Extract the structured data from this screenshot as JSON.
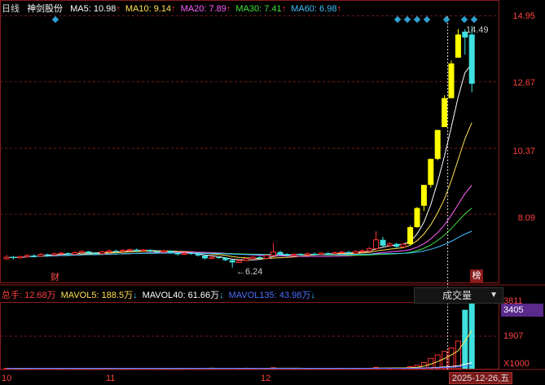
{
  "header": {
    "period": "日线",
    "stock_name": "神剑股份",
    "ma": [
      {
        "label": "MA5",
        "value": "10.98",
        "arrow": "↑",
        "color": "#ffffff"
      },
      {
        "label": "MA10",
        "value": "9.14",
        "arrow": "↑",
        "color": "#ffe050"
      },
      {
        "label": "MA20",
        "value": "7.89",
        "arrow": "↑",
        "color": "#ff60ff"
      },
      {
        "label": "MA30",
        "value": "7.41",
        "arrow": "↑",
        "color": "#40e040"
      },
      {
        "label": "MA60",
        "value": "6.98",
        "arrow": "↑",
        "color": "#40c0ff"
      }
    ]
  },
  "price_axis": [
    "14.95",
    "12.67",
    "10.37",
    "8.09"
  ],
  "annotations": {
    "high": "14.49",
    "low": "6.24",
    "cai": "财",
    "bang": "榜"
  },
  "volume_header": {
    "items": [
      {
        "label": "总手:",
        "value": "12.68万",
        "arrow": "",
        "color": "#ff4040"
      },
      {
        "label": "MAVOL5:",
        "value": "188.5万",
        "arrow": "↓",
        "color": "#ffe050"
      },
      {
        "label": "MAVOL40:",
        "value": "61.66万",
        "arrow": "↓",
        "color": "#ffffff"
      },
      {
        "label": "MAVOL135:",
        "value": "43.98万",
        "arrow": "↓",
        "color": "#5070ff"
      }
    ],
    "selector": "成交量"
  },
  "volume_axis": {
    "top": "3811",
    "current": "3405",
    "mid": "1907",
    "bottom": "X1000"
  },
  "x_axis": [
    "10",
    "11",
    "12"
  ],
  "cursor_date": "2025-12-26,五",
  "chart_data": {
    "type": "candlestick",
    "series": [
      {
        "name": "MA5"
      },
      {
        "name": "MA10"
      },
      {
        "name": "MA20"
      },
      {
        "name": "MA30"
      },
      {
        "name": "MA60"
      }
    ],
    "candles": [
      [
        6.55,
        6.6,
        6.5,
        6.68
      ],
      [
        6.6,
        6.58,
        6.52,
        6.65
      ],
      [
        6.58,
        6.62,
        6.55,
        6.66
      ],
      [
        6.62,
        6.66,
        6.58,
        6.7
      ],
      [
        6.66,
        6.64,
        6.6,
        6.7
      ],
      [
        6.64,
        6.7,
        6.62,
        6.74
      ],
      [
        6.7,
        6.68,
        6.63,
        6.72
      ],
      [
        6.68,
        6.72,
        6.65,
        6.76
      ],
      [
        6.72,
        6.74,
        6.68,
        6.78
      ],
      [
        6.74,
        6.7,
        6.66,
        6.77
      ],
      [
        6.7,
        6.76,
        6.68,
        6.8
      ],
      [
        6.76,
        6.8,
        6.72,
        6.84
      ],
      [
        6.8,
        6.74,
        6.7,
        6.82
      ],
      [
        6.74,
        6.72,
        6.68,
        6.78
      ],
      [
        6.72,
        6.78,
        6.7,
        6.82
      ],
      [
        6.78,
        6.82,
        6.74,
        6.86
      ],
      [
        6.82,
        6.8,
        6.76,
        6.86
      ],
      [
        6.8,
        6.84,
        6.78,
        6.88
      ],
      [
        6.84,
        6.86,
        6.8,
        6.9
      ],
      [
        6.86,
        6.82,
        6.78,
        6.9
      ],
      [
        6.82,
        6.85,
        6.8,
        6.88
      ],
      [
        6.85,
        6.8,
        6.76,
        6.88
      ],
      [
        6.8,
        6.78,
        6.74,
        6.84
      ],
      [
        6.78,
        6.82,
        6.76,
        6.86
      ],
      [
        6.82,
        6.76,
        6.72,
        6.84
      ],
      [
        6.76,
        6.7,
        6.66,
        6.78
      ],
      [
        6.7,
        6.74,
        6.68,
        6.78
      ],
      [
        6.74,
        6.72,
        6.68,
        6.77
      ],
      [
        6.72,
        6.66,
        6.62,
        6.74
      ],
      [
        6.66,
        6.56,
        6.52,
        6.68
      ],
      [
        6.56,
        6.6,
        6.54,
        6.64
      ],
      [
        6.6,
        6.58,
        6.55,
        6.63
      ],
      [
        6.58,
        6.5,
        6.46,
        6.6
      ],
      [
        6.5,
        6.42,
        6.24,
        6.52
      ],
      [
        6.42,
        6.48,
        6.4,
        6.52
      ],
      [
        6.48,
        6.55,
        6.46,
        6.58
      ],
      [
        6.55,
        6.6,
        6.52,
        6.64
      ],
      [
        6.6,
        6.56,
        6.52,
        6.64
      ],
      [
        6.56,
        6.66,
        6.55,
        6.7
      ],
      [
        6.66,
        6.78,
        6.6,
        7.1
      ],
      [
        6.78,
        6.7,
        6.66,
        6.82
      ],
      [
        6.7,
        6.66,
        6.62,
        6.74
      ],
      [
        6.66,
        6.7,
        6.64,
        6.74
      ],
      [
        6.7,
        6.68,
        6.64,
        6.72
      ],
      [
        6.68,
        6.72,
        6.66,
        6.76
      ],
      [
        6.72,
        6.7,
        6.66,
        6.76
      ],
      [
        6.7,
        6.74,
        6.68,
        6.78
      ],
      [
        6.74,
        6.72,
        6.68,
        6.78
      ],
      [
        6.72,
        6.76,
        6.7,
        6.8
      ],
      [
        6.76,
        6.78,
        6.72,
        6.82
      ],
      [
        6.78,
        6.74,
        6.7,
        6.82
      ],
      [
        6.74,
        6.8,
        6.72,
        6.84
      ],
      [
        6.8,
        6.82,
        6.76,
        6.88
      ],
      [
        6.82,
        6.9,
        6.78,
        6.96
      ],
      [
        6.9,
        7.2,
        6.86,
        7.5
      ],
      [
        7.2,
        7.0,
        6.96,
        7.3
      ],
      [
        7.0,
        7.06,
        6.96,
        7.12
      ],
      [
        7.06,
        6.96,
        6.92,
        7.1
      ],
      [
        6.96,
        7.05,
        6.92,
        7.1
      ],
      [
        7.05,
        7.64,
        7.02,
        7.7
      ],
      [
        7.64,
        8.3,
        7.62,
        8.34
      ],
      [
        8.38,
        9.1,
        8.2,
        9.1
      ],
      [
        9.1,
        10.0,
        9.0,
        10.0
      ],
      [
        10.0,
        11.0,
        9.95,
        11.0
      ],
      [
        11.1,
        12.1,
        12.0,
        12.2
      ],
      [
        12.1,
        13.3,
        13.1,
        13.4
      ],
      [
        13.5,
        14.3,
        14.0,
        14.49
      ],
      [
        14.4,
        14.2,
        13.6,
        14.49
      ],
      [
        14.3,
        12.6,
        12.3,
        14.6
      ]
    ],
    "volumes": [
      18,
      16,
      15,
      20,
      17,
      16,
      22,
      18,
      17,
      19,
      15,
      16,
      14,
      18,
      20,
      17,
      16,
      18,
      19,
      17,
      15,
      16,
      14,
      15,
      18,
      17,
      25,
      22,
      19,
      40,
      28,
      20,
      18,
      22,
      24,
      30,
      21,
      18,
      20,
      55,
      24,
      20,
      18,
      17,
      20,
      18,
      22,
      19,
      23,
      25,
      20,
      24,
      26,
      28,
      80,
      45,
      35,
      40,
      38,
      120,
      200,
      350,
      600,
      800,
      1000,
      1200,
      1600,
      3405,
      3811
    ]
  }
}
